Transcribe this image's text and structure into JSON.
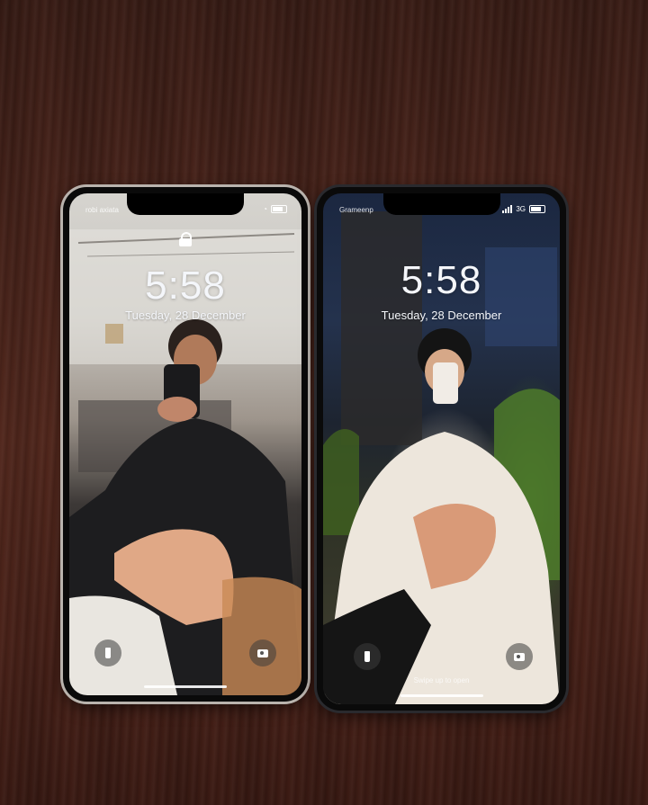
{
  "phones": [
    {
      "carrier": "robi axiata",
      "time": "5:58",
      "date": "Tuesday, 28 December",
      "icons": [
        "wifi-icon",
        "battery-icon",
        "lock-icon",
        "flashlight-icon",
        "camera-icon"
      ]
    },
    {
      "carrier": "Grameenp",
      "network": "3G",
      "time": "5:58",
      "date": "Tuesday, 28 December",
      "swipe_hint": "Swipe up to open",
      "icons": [
        "signal-icon",
        "battery-icon",
        "flashlight-icon",
        "camera-icon"
      ]
    }
  ]
}
